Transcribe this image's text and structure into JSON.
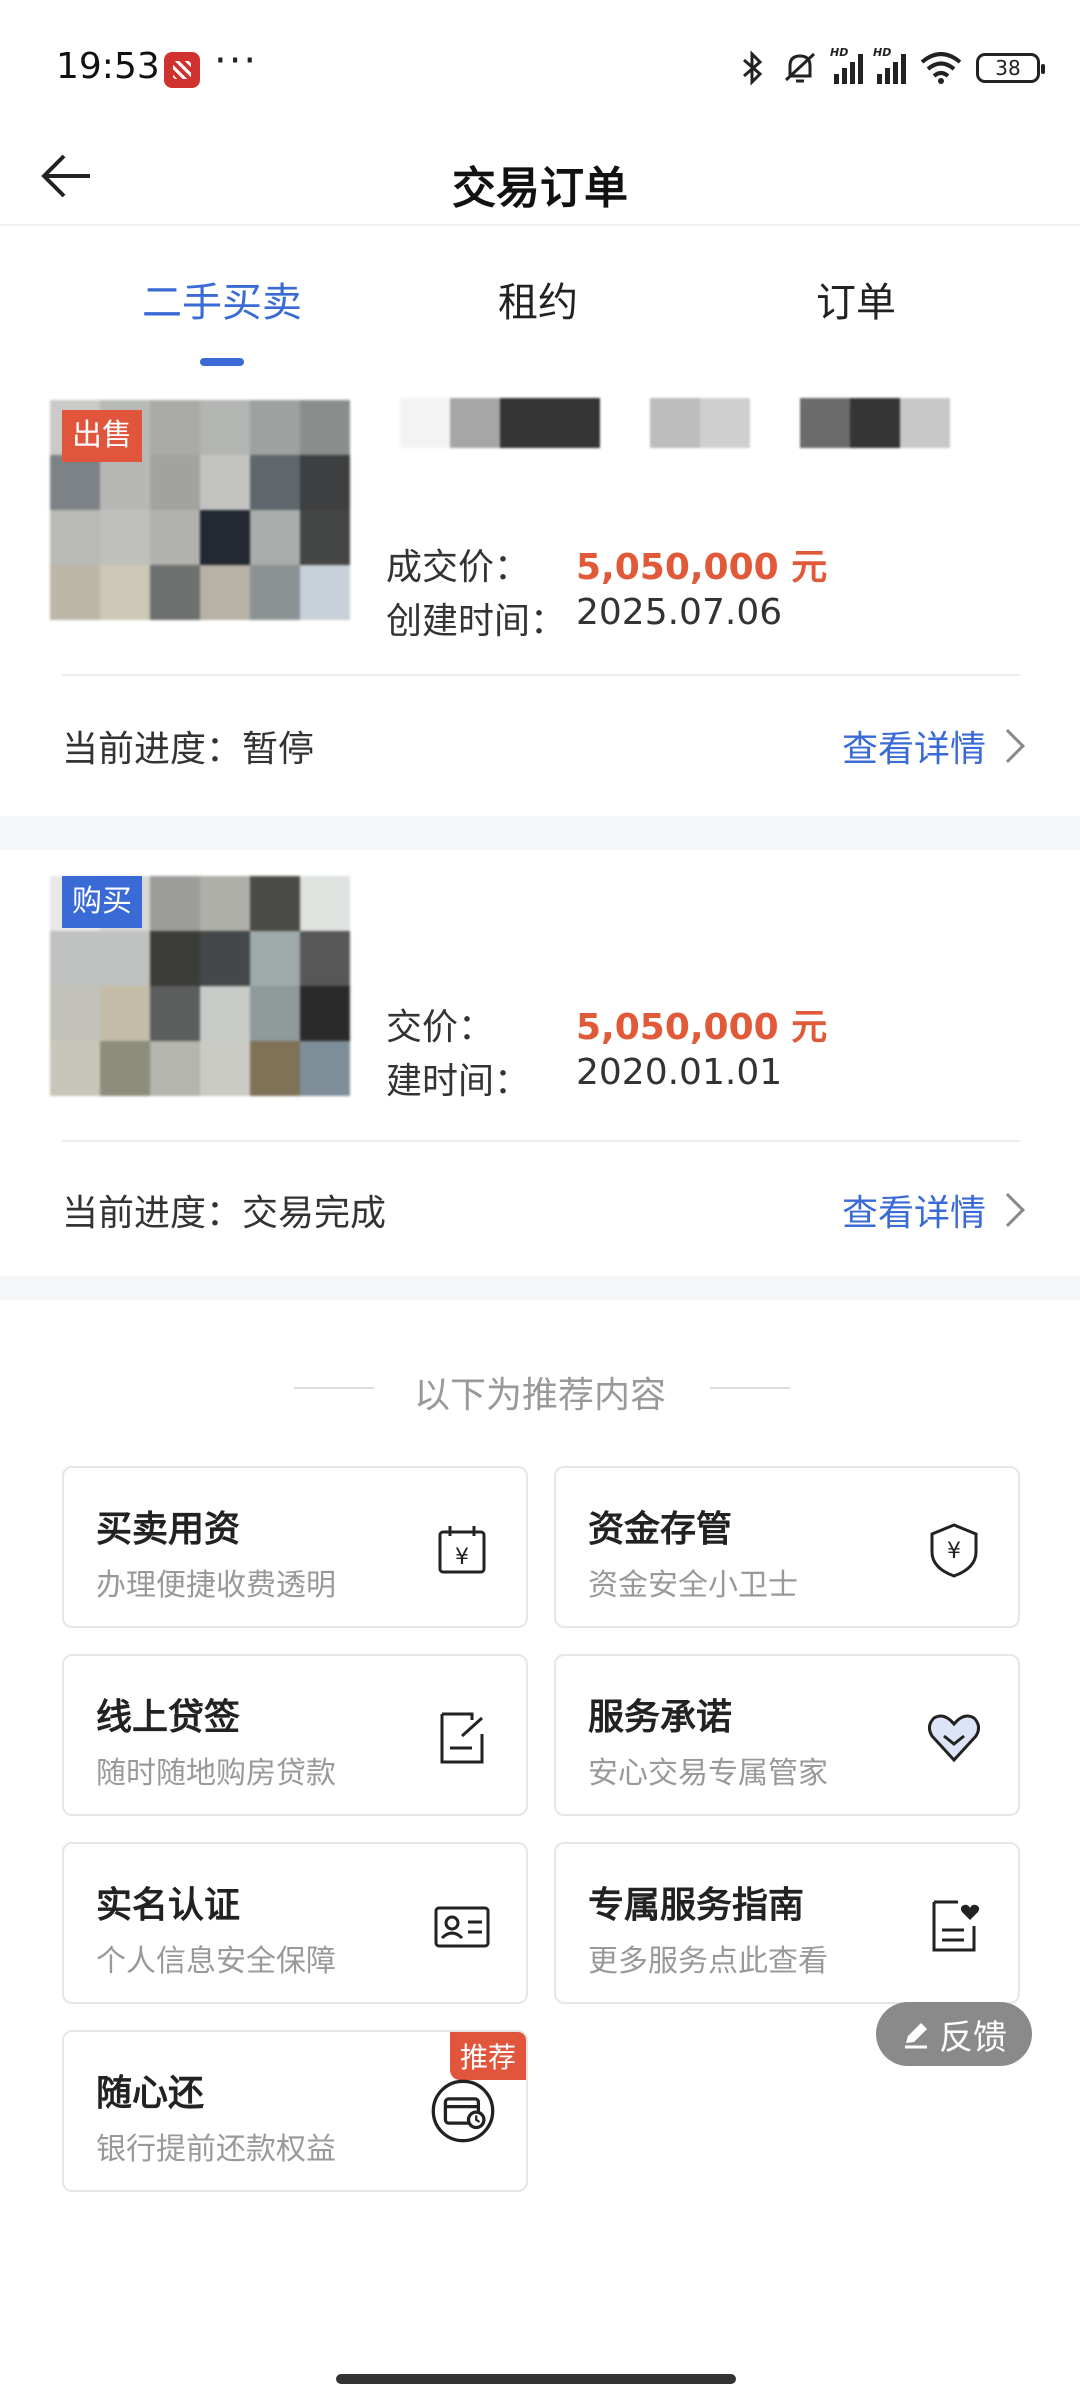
{
  "status_bar": {
    "time": "19:53",
    "dots": "···",
    "battery": "38",
    "hd1": "HD",
    "hd2": "HD"
  },
  "navbar": {
    "title": "交易订单"
  },
  "tabs": [
    {
      "label": "二手买卖",
      "active": true
    },
    {
      "label": "租约",
      "active": false
    },
    {
      "label": "订单",
      "active": false
    }
  ],
  "orders": [
    {
      "tag": "出售",
      "price_label": "成交价：",
      "price": "5,050,000 元",
      "date_label": "创建时间：",
      "date": "2025.07.06",
      "progress_label": "当前进度：",
      "progress": "暂停",
      "detail_link": "查看详情"
    },
    {
      "tag": "购买",
      "price_label": "交价：",
      "price": "5,050,000 元",
      "date_label": "建时间：",
      "date": "2020.01.01",
      "progress_label": "当前进度：",
      "progress": "交易完成",
      "detail_link": "查看详情"
    }
  ],
  "recommend": {
    "heading": "以下为推荐内容",
    "services": [
      {
        "title": "买卖用资",
        "subtitle": "办理便捷收费透明",
        "icon": "calendar-yuan-icon"
      },
      {
        "title": "资金存管",
        "subtitle": "资金安全小卫士",
        "icon": "shield-yuan-icon"
      },
      {
        "title": "线上贷签",
        "subtitle": "随时随地购房贷款",
        "icon": "document-sign-icon"
      },
      {
        "title": "服务承诺",
        "subtitle": "安心交易专属管家",
        "icon": "heart-check-icon"
      },
      {
        "title": "实名认证",
        "subtitle": "个人信息安全保障",
        "icon": "id-card-icon"
      },
      {
        "title": "专属服务指南",
        "subtitle": "更多服务点此查看",
        "icon": "guide-heart-icon"
      },
      {
        "title": "随心还",
        "subtitle": "银行提前还款权益",
        "icon": "card-clock-icon",
        "badge": "推荐"
      }
    ]
  },
  "feedback": {
    "label": "反馈"
  },
  "colors": {
    "accent": "#3a6ad6",
    "price": "#e05a3a",
    "tag_sell": "#e0553b",
    "tag_buy": "#3a6ad6"
  }
}
